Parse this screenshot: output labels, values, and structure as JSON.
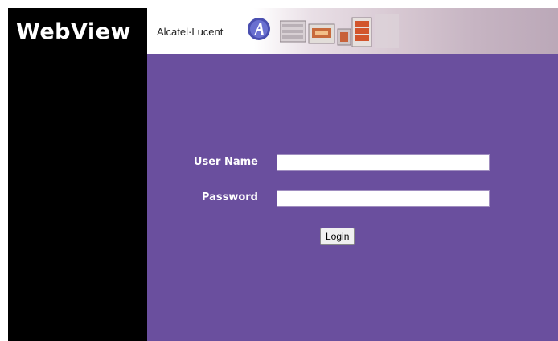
{
  "app": {
    "title": "WebView",
    "brand": "Alcatel·Lucent"
  },
  "login": {
    "username_label": "User Name",
    "username_value": "",
    "password_label": "Password",
    "password_value": "",
    "login_label": "Login"
  },
  "colors": {
    "sidebar": "#000000",
    "content_background": "#6a4f9e",
    "label_text": "#ffffff"
  },
  "icons": {
    "brand_logo": "alcatel-lucent-logo-icon",
    "banner_art": "network-equipment-illustration"
  }
}
